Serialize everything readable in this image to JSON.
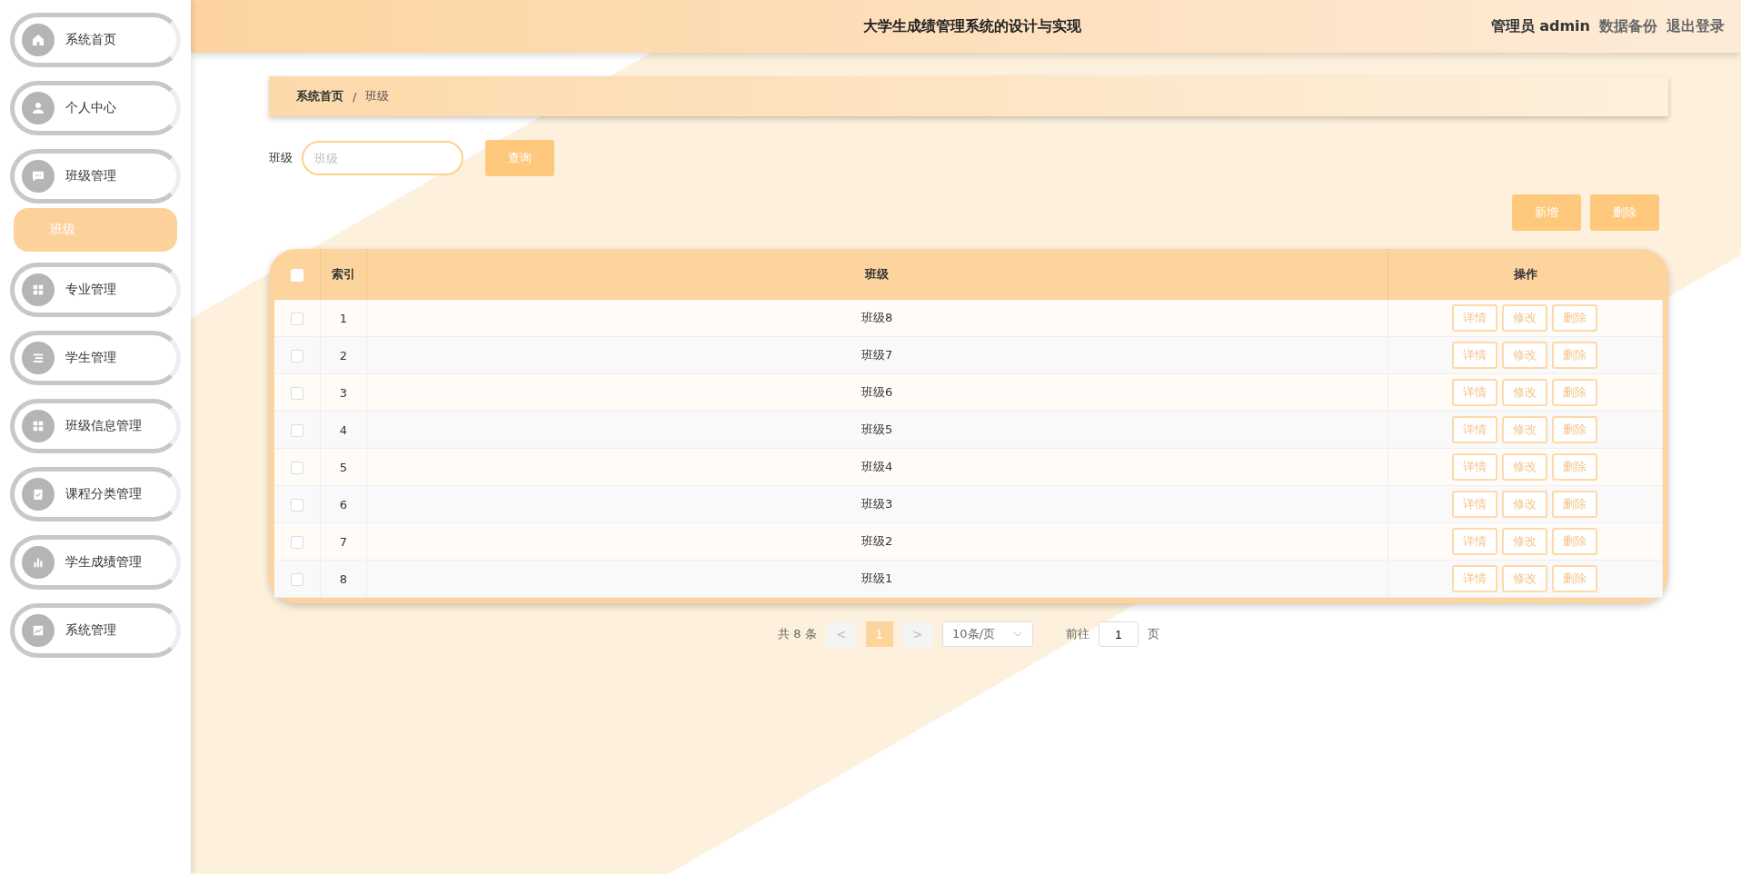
{
  "header": {
    "title": "大学生成绩管理系统的设计与实现",
    "user": "管理员 admin",
    "links": [
      "数据备份",
      "退出登录"
    ]
  },
  "sidebar": {
    "items": [
      {
        "kind": "menu",
        "label": "系统首页",
        "selected": false
      },
      {
        "kind": "menu",
        "label": "个人中心",
        "selected": false
      },
      {
        "kind": "menu",
        "label": "班级管理",
        "selected": false
      },
      {
        "kind": "submenu",
        "label": "班级",
        "selected": true
      },
      {
        "kind": "menu",
        "label": "专业管理",
        "selected": false
      },
      {
        "kind": "menu",
        "label": "学生管理",
        "selected": false
      },
      {
        "kind": "menu",
        "label": "班级信息管理",
        "selected": false
      },
      {
        "kind": "menu",
        "label": "课程分类管理",
        "selected": false
      },
      {
        "kind": "menu",
        "label": "学生成绩管理",
        "selected": false
      },
      {
        "kind": "menu",
        "label": "系统管理",
        "selected": false
      }
    ]
  },
  "breadcrumb": [
    "系统首页",
    "/",
    "班级"
  ],
  "search": {
    "label": "班级",
    "placeholder": "班级",
    "button": "查询"
  },
  "actions": [
    "新增",
    "删除"
  ],
  "table": {
    "select_all_checked": false,
    "columns": [
      "索引",
      "班级",
      "操作"
    ],
    "rows": [
      {
        "index": "1",
        "name": "班级8",
        "checked": false,
        "actions": [
          "详情",
          "修改",
          "删除"
        ]
      },
      {
        "index": "2",
        "name": "班级7",
        "checked": false,
        "actions": [
          "详情",
          "修改",
          "删除"
        ]
      },
      {
        "index": "3",
        "name": "班级6",
        "checked": false,
        "actions": [
          "详情",
          "修改",
          "删除"
        ]
      },
      {
        "index": "4",
        "name": "班级5",
        "checked": false,
        "actions": [
          "详情",
          "修改",
          "删除"
        ]
      },
      {
        "index": "5",
        "name": "班级4",
        "checked": false,
        "actions": [
          "详情",
          "修改",
          "删除"
        ]
      },
      {
        "index": "6",
        "name": "班级3",
        "checked": false,
        "actions": [
          "详情",
          "修改",
          "删除"
        ]
      },
      {
        "index": "7",
        "name": "班级2",
        "checked": false,
        "actions": [
          "详情",
          "修改",
          "删除"
        ]
      },
      {
        "index": "8",
        "name": "班级1",
        "checked": false,
        "actions": [
          "详情",
          "修改",
          "删除"
        ]
      }
    ]
  },
  "pagination": {
    "total": "共 8 条",
    "prev": "<",
    "pages": [
      {
        "label": "1",
        "selected": true
      }
    ],
    "next": ">",
    "page_size": "10条/页",
    "goto_label": "前往",
    "goto_value": "1",
    "goto_suffix": "页"
  }
}
